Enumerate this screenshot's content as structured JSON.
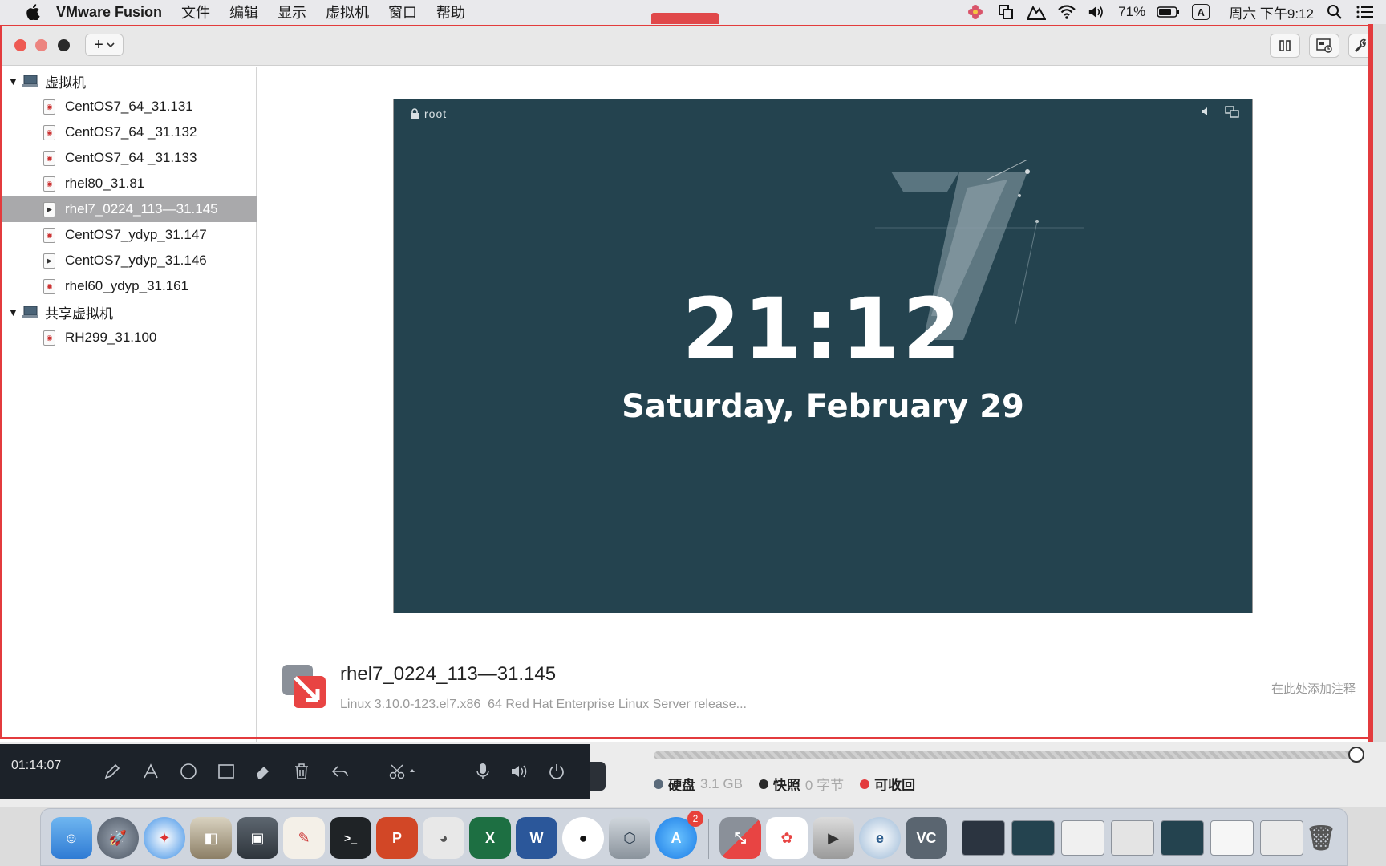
{
  "menubar": {
    "app_name": "VMware Fusion",
    "items": [
      "文件",
      "编辑",
      "显示",
      "虚拟机",
      "窗口",
      "帮助"
    ],
    "battery": "71%",
    "input_source": "A",
    "clock": "周六 下午9:12"
  },
  "toolbar": {
    "add_label": "+"
  },
  "sidebar": {
    "groups": [
      {
        "label": "虚拟机",
        "items": [
          {
            "label": "CentOS7_64_31.131",
            "running": false
          },
          {
            "label": "CentOS7_64 _31.132",
            "running": false
          },
          {
            "label": "CentOS7_64 _31.133",
            "running": false
          },
          {
            "label": "rhel80_31.81",
            "running": false
          },
          {
            "label": "rhel7_0224_113—31.145",
            "running": true,
            "selected": true
          },
          {
            "label": "CentOS7_ydyp_31.147",
            "running": false
          },
          {
            "label": "CentOS7_ydyp_31.146",
            "running": true
          },
          {
            "label": "rhel60_ydyp_31.161",
            "running": false
          }
        ]
      },
      {
        "label": "共享虚拟机",
        "items": [
          {
            "label": "RH299_31.100",
            "running": false
          }
        ]
      }
    ]
  },
  "vm_screen": {
    "user": "root",
    "time": "21:12",
    "date": "Saturday, February 29",
    "background": "#24434f"
  },
  "vm_info": {
    "name": "rhel7_0224_113—31.145",
    "description": "Linux 3.10.0-123.el7.x86_64 Red Hat Enterprise Linux Server release...",
    "notes_placeholder": "在此处添加注释"
  },
  "storage": {
    "disk_label": "硬盘",
    "disk_value": "3.1 GB",
    "snapshot_label": "快照",
    "snapshot_value": "0 字节",
    "reclaim_label": "可收回",
    "colors": {
      "disk": "#5a6a7a",
      "snapshot": "#2a2a2a",
      "reclaim": "#e33b3d"
    }
  },
  "recorder": {
    "elapsed": "01:14:07"
  },
  "dock": {
    "appstore_badge": "2"
  },
  "colors": {
    "accent": "#e33b3d",
    "selection": "#a9a9ab"
  }
}
